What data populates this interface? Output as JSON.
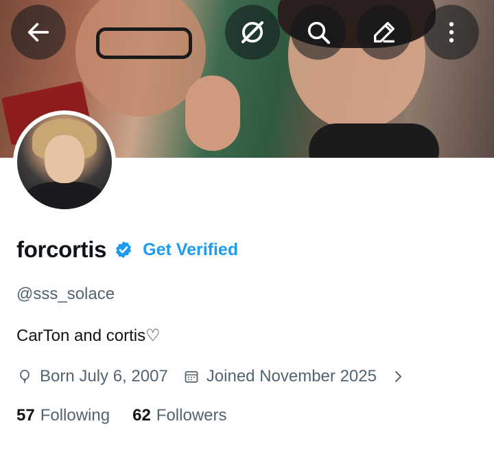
{
  "header": {
    "buttons": [
      {
        "name": "back-arrow-icon"
      },
      {
        "name": "grok-icon"
      },
      {
        "name": "search-icon"
      },
      {
        "name": "edit-pen-icon"
      },
      {
        "name": "more-vertical-icon"
      }
    ]
  },
  "profile": {
    "display_name": "forcortis",
    "verified": true,
    "get_verified_label": "Get Verified",
    "handle": "@sss_solace",
    "bio": "CarTon and cortis♡",
    "birth": "Born July 6, 2007",
    "joined": "Joined November 2025",
    "following_count": "57",
    "following_label": "Following",
    "followers_count": "62",
    "followers_label": "Followers"
  },
  "colors": {
    "accent": "#1d9bf0",
    "text_primary": "#0f1419",
    "text_secondary": "#536471"
  }
}
